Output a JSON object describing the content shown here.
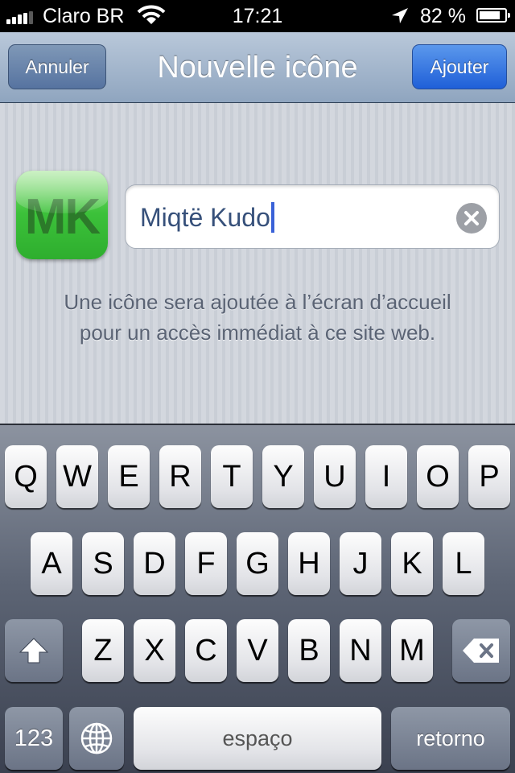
{
  "status_bar": {
    "carrier": "Claro BR",
    "time": "17:21",
    "battery_percent_label": "82 %",
    "battery_level": 0.82,
    "icons": [
      "signal-bars-icon",
      "wifi-icon",
      "location-arrow-icon",
      "battery-icon"
    ]
  },
  "nav": {
    "title": "Nouvelle icône",
    "cancel_label": "Annuler",
    "add_label": "Ajouter"
  },
  "content": {
    "icon_initials": "MK",
    "name_value": "Miqtë Kudo",
    "help_line1": "Une icône sera ajoutée à l’écran d’accueil",
    "help_line2": "pour un accès immédiat à ce site web."
  },
  "keyboard": {
    "row1": [
      "Q",
      "W",
      "E",
      "R",
      "T",
      "Y",
      "U",
      "I",
      "O",
      "P"
    ],
    "row2": [
      "A",
      "S",
      "D",
      "F",
      "G",
      "H",
      "J",
      "K",
      "L"
    ],
    "row3": [
      "Z",
      "X",
      "C",
      "V",
      "B",
      "N",
      "M"
    ],
    "numbers_label": "123",
    "space_label": "espaço",
    "return_label": "retorno"
  },
  "colors": {
    "accent_blue": "#2a66dc",
    "icon_green": "#3cc13a",
    "nav_blue": "#8fa5bf"
  }
}
